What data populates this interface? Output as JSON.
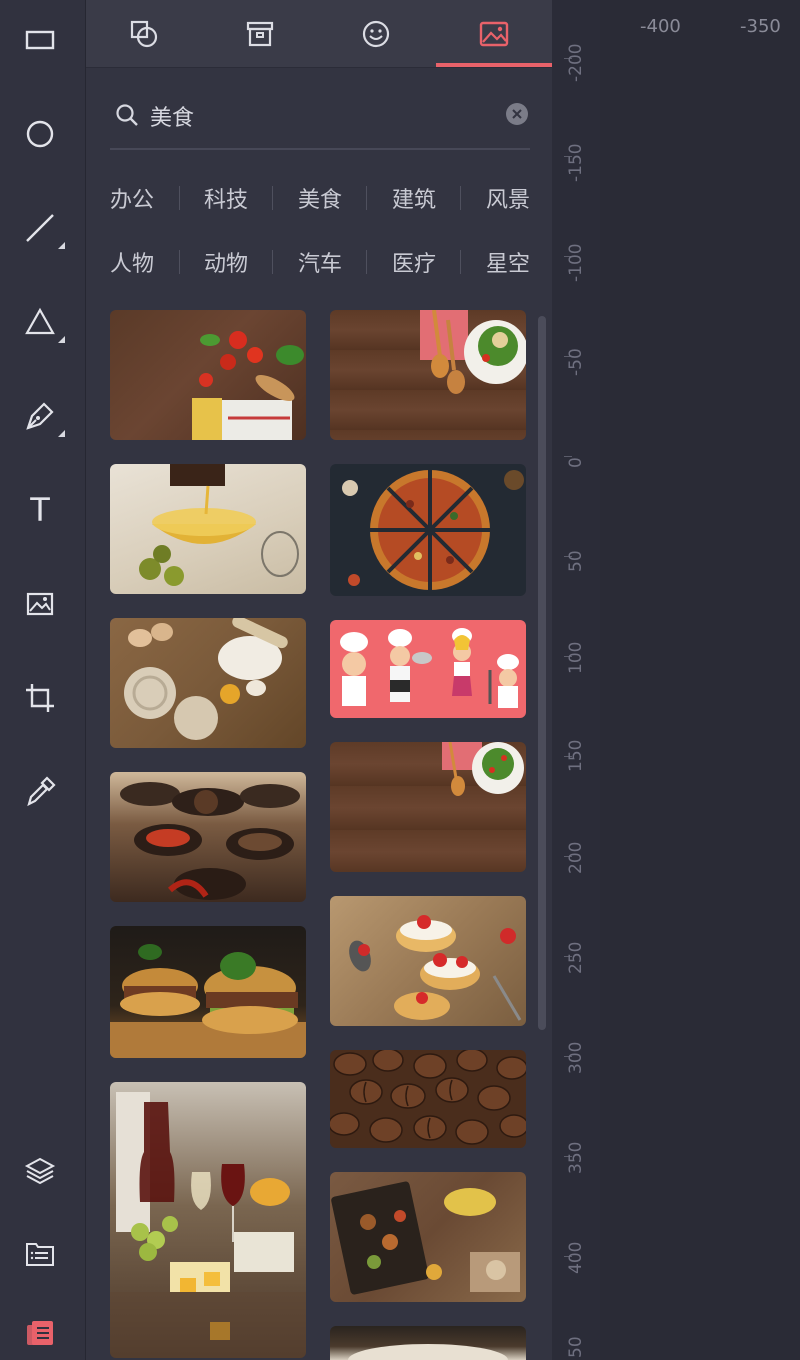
{
  "toolbar": {
    "tools": [
      {
        "name": "rectangle-icon"
      },
      {
        "name": "ellipse-icon"
      },
      {
        "name": "line-icon"
      },
      {
        "name": "triangle-icon"
      },
      {
        "name": "pen-icon"
      },
      {
        "name": "text-icon",
        "glyph": "T"
      },
      {
        "name": "image-icon"
      },
      {
        "name": "crop-icon"
      },
      {
        "name": "eyedropper-icon"
      }
    ],
    "bottom": [
      {
        "name": "layers-icon"
      },
      {
        "name": "file-list-icon"
      },
      {
        "name": "template-icon"
      }
    ]
  },
  "panel": {
    "tabs": [
      {
        "name": "shapes-icon"
      },
      {
        "name": "archive-icon"
      },
      {
        "name": "emoji-icon"
      },
      {
        "name": "picture-icon",
        "active": true
      }
    ],
    "search": {
      "value": "美食"
    },
    "categories_row1": [
      "办公",
      "科技",
      "美食",
      "建筑",
      "风景"
    ],
    "categories_row2": [
      "人物",
      "动物",
      "汽车",
      "医疗",
      "星空"
    ],
    "images": [
      "tomatoes-pasta-wood",
      "salad-spoons-wood",
      "olive-oil-bowl",
      "pizza-slices",
      "flour-pasta-eggs",
      "chef-cartoons",
      "spice-bowls",
      "salad-wood-table",
      "burgers-basil",
      "cream-puffs-strawberry",
      "wine-cheese-board",
      "coffee-beans",
      "food-platter-wood",
      "kitchen-partial"
    ]
  },
  "ruler": {
    "horizontal": [
      "-400",
      "-350"
    ],
    "vertical": [
      "-200",
      "-150",
      "-100",
      "-50",
      "0",
      "50",
      "100",
      "150",
      "200",
      "250",
      "300",
      "350",
      "400",
      "50"
    ]
  },
  "colors": {
    "accent": "#e9626a",
    "panel": "#333441",
    "toolbar": "#31323f"
  }
}
